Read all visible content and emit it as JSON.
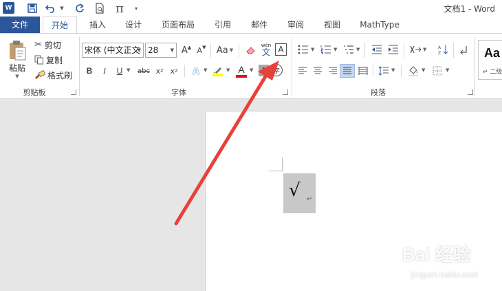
{
  "window": {
    "title": "文档1 - Word"
  },
  "quick_access": {
    "word_logo": "W",
    "items": [
      {
        "icon": "word-logo-icon"
      },
      {
        "icon": "save-icon"
      },
      {
        "icon": "undo-icon"
      },
      {
        "icon": "redo-icon"
      },
      {
        "icon": "print-preview-icon"
      },
      {
        "icon": "equation-pi-icon",
        "glyph": "π"
      },
      {
        "icon": "customize-dropdown-icon"
      }
    ]
  },
  "tabs": {
    "file": "文件",
    "home": "开始",
    "insert": "插入",
    "design": "设计",
    "layout": "页面布局",
    "references": "引用",
    "mailings": "邮件",
    "review": "审阅",
    "view": "视图",
    "mathtype": "MathType"
  },
  "clipboard": {
    "paste": "粘贴",
    "cut": "剪切",
    "copy": "复制",
    "format_painter": "格式刷",
    "group_label": "剪贴板"
  },
  "font": {
    "font_name": "宋体 (中文正文",
    "font_size": "28",
    "grow": "A",
    "shrink": "A",
    "change_case": "Aa",
    "bold": "B",
    "italic": "I",
    "underline": "U",
    "strikethrough": "abc",
    "subscript": "x",
    "subscript_mark": "2",
    "superscript": "x",
    "superscript_mark": "2",
    "text_effects": "A",
    "font_color": "A",
    "char_shading": "A",
    "enclose": "字",
    "phonetic_top": "wén",
    "phonetic_bottom": "文",
    "char_border": "A",
    "group_label": "字体"
  },
  "paragraph": {
    "group_label": "段落"
  },
  "styles": {
    "preview": "Aa",
    "name": "↵ 二级"
  },
  "document": {
    "content_text": "√",
    "paragraph_mark": "↵"
  },
  "watermark": {
    "main": "Bai 经验",
    "sub": "jingyan.baidu.com"
  },
  "colors": {
    "brand": "#2b579a",
    "arrow": "#e8413b",
    "highlight": "#ffff00",
    "font_color": "#e81123"
  }
}
